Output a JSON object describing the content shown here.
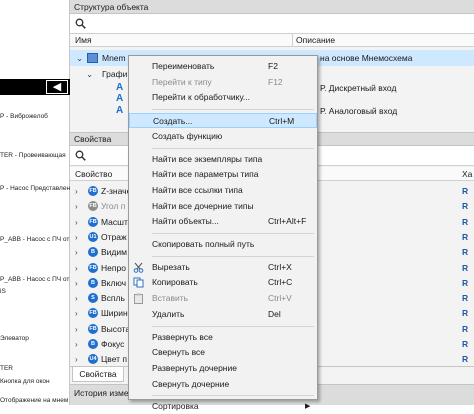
{
  "left_canvas": {
    "labels": [
      "Р - Виброжелоб",
      "TER - Провеивающая",
      "Р - Насос Представлен",
      "Р_АВВ - Насос с ПЧ от",
      "Р_АВВ - Насос с ПЧ от",
      "іS",
      "Элеватор",
      "TER",
      "Кнопка для окон",
      "Отображение на мнем"
    ]
  },
  "structure_panel": {
    "title": "Структура объекта",
    "columns": {
      "name": "Имя",
      "description": "Описание"
    },
    "rows": [
      {
        "name": "Mnem",
        "description": "на основе Мнемосхема"
      },
      {
        "name": "Графи",
        "description": ""
      },
      {
        "name": "",
        "description": "Р. Дискретный вход"
      },
      {
        "name": "",
        "description": ""
      },
      {
        "name": "",
        "description": "Р. Аналоговый вход"
      }
    ]
  },
  "properties_panel": {
    "title": "Свойства",
    "columns": {
      "property": "Свойство",
      "right": "Ха"
    },
    "rows": [
      {
        "icon": "FB",
        "label": "Z-значе",
        "color": "#1e6fd0",
        "muted": false,
        "right": "R"
      },
      {
        "icon": "FB",
        "label": "Угол п",
        "color": "#8c8c8c",
        "muted": true,
        "right": "R"
      },
      {
        "icon": "FB",
        "label": "Масшт",
        "color": "#1e6fd0",
        "muted": false,
        "right": "R"
      },
      {
        "icon": "U1",
        "label": "Отраж",
        "color": "#1e6fd0",
        "muted": false,
        "right": "R"
      },
      {
        "icon": "B",
        "label": "Видим",
        "color": "#1e6fd0",
        "muted": false,
        "right": "R"
      },
      {
        "icon": "FB",
        "label": "Непро",
        "color": "#1e6fd0",
        "muted": false,
        "right": "R"
      },
      {
        "icon": "B",
        "label": "Включ",
        "color": "#1e6fd0",
        "muted": false,
        "right": "R"
      },
      {
        "icon": "S",
        "label": "Вспль",
        "color": "#1e6fd0",
        "muted": false,
        "right": "R"
      },
      {
        "icon": "FB",
        "label": "Ширин",
        "color": "#1e6fd0",
        "muted": false,
        "right": "R"
      },
      {
        "icon": "FB",
        "label": "Высота",
        "color": "#1e6fd0",
        "muted": false,
        "right": "R"
      },
      {
        "icon": "B",
        "label": "Фокус",
        "color": "#1e6fd0",
        "muted": false,
        "right": "R"
      },
      {
        "icon": "U4",
        "label": "Цвет п",
        "color": "#1e6fd0",
        "muted": false,
        "right": "R"
      }
    ],
    "tab_label": "Свойства"
  },
  "history_panel": {
    "title": "История изме"
  },
  "context_menu": {
    "items": [
      {
        "label": "Переименовать",
        "shortcut": "F2",
        "disabled": false
      },
      {
        "label": "Перейти к типу",
        "shortcut": "F12",
        "disabled": true
      },
      {
        "label": "Перейти к обработчику...",
        "shortcut": "",
        "disabled": false
      },
      {
        "sep": true
      },
      {
        "label": "Создать...",
        "shortcut": "Ctrl+M",
        "disabled": false,
        "highlight": true
      },
      {
        "label": "Создать функцию",
        "shortcut": "",
        "disabled": false
      },
      {
        "sep": true
      },
      {
        "label": "Найти все экземпляры типа",
        "shortcut": "",
        "disabled": false
      },
      {
        "label": "Найти все параметры типа",
        "shortcut": "",
        "disabled": false
      },
      {
        "label": "Найти все ссылки типа",
        "shortcut": "",
        "disabled": false
      },
      {
        "label": "Найти все дочерние типы",
        "shortcut": "",
        "disabled": false
      },
      {
        "label": "Найти объекты...",
        "shortcut": "Ctrl+Alt+F",
        "disabled": false
      },
      {
        "sep": true
      },
      {
        "label": "Скопировать полный путь",
        "shortcut": "",
        "disabled": false
      },
      {
        "sep": true
      },
      {
        "label": "Вырезать",
        "shortcut": "Ctrl+X",
        "disabled": false,
        "icon": "scissors-icon"
      },
      {
        "label": "Копировать",
        "shortcut": "Ctrl+C",
        "disabled": false,
        "icon": "copy-icon"
      },
      {
        "label": "Вставить",
        "shortcut": "Ctrl+V",
        "disabled": true,
        "icon": "paste-icon"
      },
      {
        "label": "Удалить",
        "shortcut": "Del",
        "disabled": false
      },
      {
        "sep": true
      },
      {
        "label": "Развернуть все",
        "shortcut": "",
        "disabled": false
      },
      {
        "label": "Свернуть все",
        "shortcut": "",
        "disabled": false
      },
      {
        "label": "Развернуть дочерние",
        "shortcut": "",
        "disabled": false
      },
      {
        "label": "Свернуть дочерние",
        "shortcut": "",
        "disabled": false
      },
      {
        "sep": true
      },
      {
        "label": "Сортировка",
        "shortcut": "",
        "disabled": false,
        "submenu": true
      }
    ]
  },
  "colors": {
    "accent": "#1e6fd0",
    "highlight": "#cde8ff"
  }
}
